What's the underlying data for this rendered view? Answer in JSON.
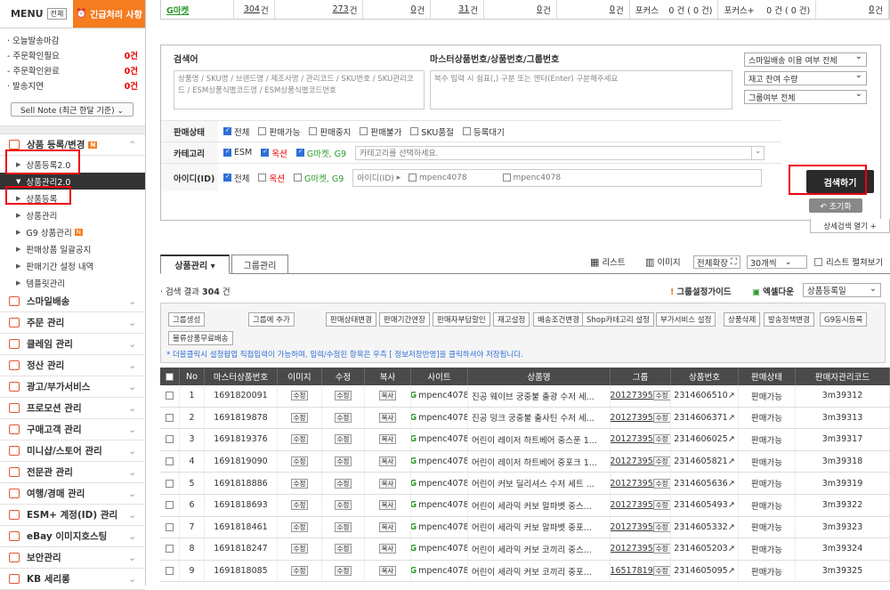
{
  "sidebar": {
    "menu": "MENU",
    "all": "전체",
    "urgent": "긴급처리 사항",
    "today": [
      {
        "label": "· 오늘발송마감",
        "count": ""
      },
      {
        "label": "- 주문확인필요",
        "count": "0건"
      },
      {
        "label": "- 주문확인완료",
        "count": "0건"
      },
      {
        "label": "· 발송지연",
        "count": "0건"
      }
    ],
    "sellnote": "Sell Note (최근 한달 기준) ⌄",
    "cat_main": "상품 등록/변경",
    "subs": [
      "상품등록2.0",
      "상품관리2.0",
      "상품등록",
      "상품관리",
      "G9 상품관리",
      "판매상품 일괄공지",
      "판매기간 설정 내역",
      "템플릿관리"
    ],
    "cats": [
      "스마일배송",
      "주문 관리",
      "클레임 관리",
      "정산 관리",
      "광고/부가서비스",
      "프로모션 관리",
      "구매고객 관리",
      "미니샵/스토어 관리",
      "전문관 관리",
      "여행/경매 관리",
      "ESM+ 계정(ID) 관리",
      "eBay 이미지호스팅",
      "보안관리",
      "KB 세리롱"
    ]
  },
  "topbar": [
    {
      "a": "G마켓",
      "b": ""
    },
    {
      "a": "304",
      "b": "건"
    },
    {
      "a": "273",
      "b": "건"
    },
    {
      "a": "0",
      "b": "건"
    },
    {
      "a": "31",
      "b": "건"
    },
    {
      "a": "0",
      "b": "건"
    },
    {
      "a": "0",
      "b": "건"
    },
    {
      "a": "포커스",
      "b": "0 건 ( 0 건)"
    },
    {
      "a": "포커스+",
      "b": "0 건 ( 0 건)"
    },
    {
      "a": "0",
      "b": "건"
    }
  ],
  "search": {
    "kw_title": "검색어",
    "kw_ph": "상품명 / SKU명 / 브랜드명 / 제조사명 / 관리코드 / SKU번호 / SKU관리코드 / ESM상품식별코드명 / ESM상품식별코드번호",
    "mc_title": "마스터상품번호/상품번호/그룹번호",
    "mc_ph": "복수 입력 시 쉼표(,) 구분 또는 엔터(Enter) 구분해주세요",
    "sel1": "스마일배송 이용 여부 전체",
    "sel2": "재고 잔여 수량",
    "sel3": "그룹여부 전체",
    "status_label": "판매상태",
    "status": [
      "전체",
      "판매가능",
      "판매중지",
      "판매불가",
      "SKU품절",
      "등록대기"
    ],
    "cat_label": "카테고리",
    "cat_opts": [
      "ESM",
      "옥션",
      "G마켓, G9"
    ],
    "cat_ph": "카테고리를 선택하세요.",
    "id_label": "아이디(ID)",
    "id_opts": [
      "전체",
      "옥션",
      "G마켓, G9"
    ],
    "id_ph": "아이디(ID)",
    "id1": "mpenc4078",
    "id2": "mpenc4078",
    "search_btn": "검색하기",
    "reset_btn": "↶ 초기화",
    "detail": "상세검색 열기 +"
  },
  "tabs": {
    "t1": "상품관리 ▾",
    "t2": "그룹관리",
    "list": "리스트",
    "image": "이미지",
    "expand": "전체확장",
    "per": "30개씩",
    "wide": "리스트 펼쳐보기"
  },
  "result": {
    "prefix": "· 검색 결과 ",
    "count": "304",
    "suffix": " 건",
    "guide": "그룹설정가이드",
    "excel": "엑셀다운",
    "sort": "상품등록일"
  },
  "toolbar": {
    "row1": [
      "그룹생성",
      "그룹에 추가",
      "판매상태변경",
      "판매기간연장",
      "판매자부담할인",
      "재고설정",
      "배송조건변경",
      "Shop카테고리 설정",
      "부가서비스 설정",
      "상품삭제",
      "발송정책변경",
      "G9동시등록"
    ],
    "row2": [
      "물류상품무료배송"
    ],
    "note": "* 더블클릭시 설정팝업 직접입력이 가능하며, 입력/수정된 항목은 우측 [ 정보저장반영]을 클릭하셔야 저장됩니다."
  },
  "table": {
    "headers": [
      "",
      "No",
      "마스터상품번호",
      "이미지",
      "수정",
      "복사",
      "사이트",
      "상품명",
      "그룹",
      "상품번호",
      "판매상태",
      "판매자관리코드"
    ],
    "rows": [
      [
        "1",
        "1691820091",
        "mpenc4078",
        "진공 웨이브 궁중불 출광 수저 세...",
        "20127395",
        "2314606510",
        "판매가능",
        "3m39312"
      ],
      [
        "2",
        "1691819878",
        "mpenc4078",
        "진공 밍크 궁중불 출사틴 수저 세...",
        "20127395",
        "2314606371",
        "판매가능",
        "3m39313"
      ],
      [
        "3",
        "1691819376",
        "mpenc4078",
        "어린이 레이저 하트베어 중스푼 1...",
        "20127395",
        "2314606025",
        "판매가능",
        "3m39317"
      ],
      [
        "4",
        "1691819090",
        "mpenc4078",
        "어린이 레이저 하트베어 중포크 1...",
        "20127395",
        "2314605821",
        "판매가능",
        "3m39318"
      ],
      [
        "5",
        "1691818886",
        "mpenc4078",
        "어린이 커보 딜리셔스 수저 세트 ...",
        "20127395",
        "2314605636",
        "판매가능",
        "3m39319"
      ],
      [
        "6",
        "1691818693",
        "mpenc4078",
        "어린이 세라믹 커보 알파벳 중스...",
        "20127395",
        "2314605493",
        "판매가능",
        "3m39322"
      ],
      [
        "7",
        "1691818461",
        "mpenc4078",
        "어린이 세라믹 커보 알파벳 중포...",
        "20127395",
        "2314605332",
        "판매가능",
        "3m39323"
      ],
      [
        "8",
        "1691818247",
        "mpenc4078",
        "어린이 세라믹 커보 코끼리 중스...",
        "20127395",
        "2314605203",
        "판매가능",
        "3m39324"
      ],
      [
        "9",
        "1691818085",
        "mpenc4078",
        "어린이 세라믹 커보 코끼리 중포...",
        "16517819",
        "2314605095",
        "판매가능",
        "3m39325"
      ]
    ],
    "img_btn": "수정",
    "edit_btn": "수정",
    "copy_btn": "복사",
    "grp_btn": "수정",
    "site_g": "G"
  }
}
